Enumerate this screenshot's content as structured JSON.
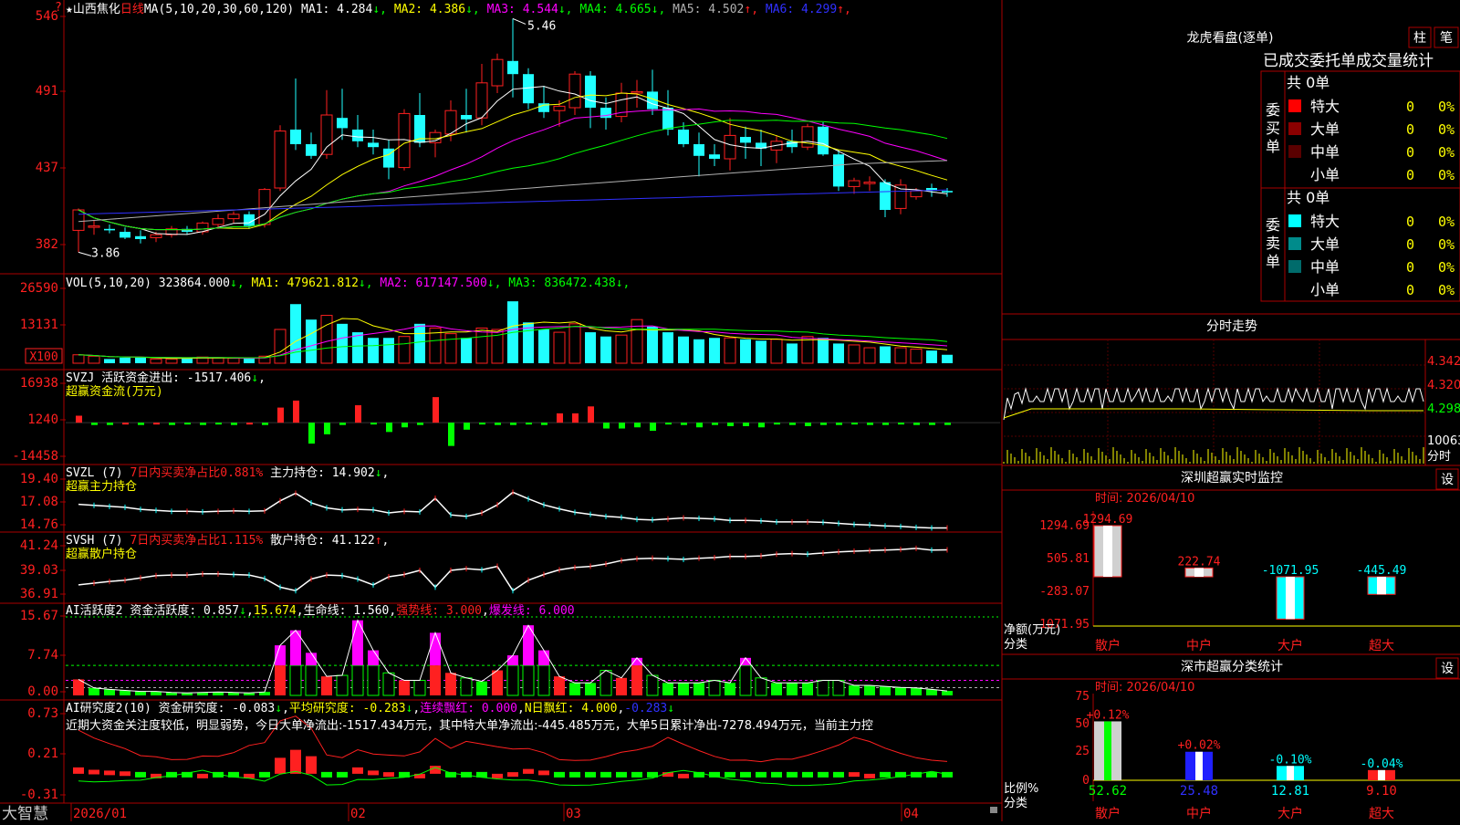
{
  "app": {
    "name": "大智慧",
    "top_icon": "?"
  },
  "colors": {
    "up": "#ff2020",
    "down": "#20ffff",
    "grid": "#aa0000",
    "white": "#ffffff",
    "yellow": "#ffff00",
    "magenta": "#ff00ff",
    "green": "#00ff00",
    "blue": "#3030ff",
    "gray": "#b0b0b0",
    "cyan": "#00ffff"
  },
  "main": {
    "star": "★",
    "stock_name": "山西焦化",
    "period": "日线",
    "ma_param": "MA(5,10,20,30,60,120)",
    "legend": [
      {
        "label": "MA1:",
        "value": "4.284",
        "arrow": "↓",
        "color": "#ffffff"
      },
      {
        "label": "MA2:",
        "value": "4.386",
        "arrow": "↓",
        "color": "#ffff00"
      },
      {
        "label": "MA3:",
        "value": "4.544",
        "arrow": "↓",
        "color": "#ff00ff"
      },
      {
        "label": "MA4:",
        "value": "4.665",
        "arrow": "↓",
        "color": "#00ff00"
      },
      {
        "label": "MA5:",
        "value": "4.502",
        "arrow": "↑",
        "color": "#b0b0b0"
      },
      {
        "label": "MA6:",
        "value": "4.299",
        "arrow": "↑",
        "color": "#3030ff"
      }
    ],
    "y_labels": [
      "546",
      "491",
      "437",
      "382"
    ],
    "high_label": "5.46",
    "low_label": "3.86"
  },
  "vol": {
    "title": "VOL(5,10,20)",
    "value": "323864.000",
    "arrow": "↓",
    "legend": [
      {
        "label": "MA1:",
        "value": "479621.812",
        "arrow": "↓",
        "color": "#ffff00"
      },
      {
        "label": "MA2:",
        "value": "617147.500",
        "arrow": "↓",
        "color": "#ff00ff"
      },
      {
        "label": "MA3:",
        "value": "836472.438",
        "arrow": "↓",
        "color": "#00ff00"
      }
    ],
    "y_labels": [
      "26590",
      "13131"
    ],
    "unit": "X100"
  },
  "svzj": {
    "title": "SVZJ",
    "desc": "活跃资金进出:",
    "value": "-1517.406",
    "arrow": "↓",
    "tail": ",",
    "subtitle": "超赢资金流(万元)",
    "y_labels": [
      "16938",
      "1240",
      "-14458"
    ]
  },
  "svzl": {
    "title": "SVZL (7)",
    "desc": "7日内买卖净占比0.881%",
    "hold_label": "主力持仓:",
    "hold_value": "14.902",
    "arrow": "↓",
    "tail": ",",
    "subtitle": "超赢主力持仓",
    "y_labels": [
      "19.40",
      "17.08",
      "14.76"
    ]
  },
  "svsh": {
    "title": "SVSH (7)",
    "desc": "7日内买卖净占比1.115%",
    "hold_label": "散户持仓:",
    "hold_value": "41.122",
    "arrow": "↑",
    "tail": ",",
    "subtitle": "超赢散户持仓",
    "y_labels": [
      "41.24",
      "39.03",
      "36.91"
    ]
  },
  "ai_act": {
    "title": "AI活跃度2",
    "items": [
      {
        "text": "资金活跃度: 0.857",
        "arrow": "↓",
        "color": "#ffffff"
      },
      {
        "text": "15.674",
        "arrow": "",
        "color": "#ffff00",
        "prefix": ","
      },
      {
        "text": "生命线: 1.560",
        "arrow": "",
        "color": "#ffffff",
        "prefix": ","
      },
      {
        "text": "强势线: 3.000",
        "arrow": "",
        "color": "#ff2020",
        "prefix": ","
      },
      {
        "text": "爆发线: 6.000",
        "arrow": "",
        "color": "#ff00ff",
        "prefix": ","
      }
    ],
    "y_labels": [
      "15.67",
      "7.74",
      "0.00"
    ]
  },
  "ai_res": {
    "title": "AI研究度2(10)",
    "items": [
      {
        "text": "资金研究度: -0.083",
        "arrow": "↓",
        "color": "#ffffff"
      },
      {
        "text": "平均研究度: -0.283",
        "arrow": "↓",
        "color": "#ffff00",
        "prefix": ","
      },
      {
        "text": "连续飘红: 0.000",
        "arrow": "",
        "color": "#ff00ff",
        "prefix": ","
      },
      {
        "text": "N日飘红: 4.000",
        "arrow": "",
        "color": "#ffff00",
        "prefix": ","
      },
      {
        "text": "-0.283",
        "arrow": "↓",
        "color": "#3030ff",
        "prefix": ","
      }
    ],
    "comment": "近期大资金关注度较低，明显弱势，今日大单净流出:-1517.434万元，其中特大单净流出:-445.485万元，大单5日累计净出-7278.494万元，当前主力控",
    "y_labels": [
      "0.73",
      "0.21",
      "-0.31"
    ]
  },
  "x_axis": {
    "labels": [
      "2026/01",
      "02",
      "03",
      "04"
    ]
  },
  "right": {
    "dragon_title": "龙虎看盘(逐单)",
    "btn1": "柱",
    "btn2": "笔",
    "stat_header": "已成交委托单成交量统计",
    "buy_side": "委买单",
    "sell_side": "委卖单",
    "buy_total": "共 0单",
    "sell_total": "共 0单",
    "buy_rows": [
      {
        "name": "特大",
        "count": "0",
        "pct": "0%",
        "color": "#ff0000"
      },
      {
        "name": "大单",
        "count": "0",
        "pct": "0%",
        "color": "#8b0000"
      },
      {
        "name": "中单",
        "count": "0",
        "pct": "0%",
        "color": "#5a0000"
      },
      {
        "name": "小单",
        "count": "0",
        "pct": "0%",
        "color": "#000000"
      }
    ],
    "sell_rows": [
      {
        "name": "特大",
        "count": "0",
        "pct": "0%",
        "color": "#00ffff"
      },
      {
        "name": "大单",
        "count": "0",
        "pct": "0%",
        "color": "#008b8b"
      },
      {
        "name": "中单",
        "count": "0",
        "pct": "0%",
        "color": "#006b6b"
      },
      {
        "name": "小单",
        "count": "0",
        "pct": "0%",
        "color": "#000000"
      }
    ],
    "tick_title": "分时走势",
    "tick_labels": [
      "4.342",
      "4.320",
      "4.298",
      "10063",
      "分时"
    ],
    "sz_title": "深圳超赢实时监控",
    "settings": "设",
    "sz_time": "时间: 2026/04/10",
    "sz_y": [
      "1294.69",
      "505.81",
      "-283.07",
      "-1071.95"
    ],
    "sz_unit": "净额(万元)",
    "sz_cat_label": "分类",
    "categories": [
      "散户",
      "中户",
      "大户",
      "超大"
    ],
    "sz_values": [
      "1294.69",
      "222.74",
      "-1071.95",
      "-445.49"
    ],
    "cls_title": "深市超赢分类统计",
    "cls_time": "时间: 2026/04/10",
    "cls_y": [
      "75",
      "50",
      "25",
      "0"
    ],
    "cls_unit": "比例%",
    "cls_cat_label": "分类",
    "cls_top": [
      "+0.12%",
      "+0.02%",
      "-0.10%",
      "-0.04%"
    ],
    "cls_bottom": [
      "52.62",
      "25.48",
      "12.81",
      "9.10"
    ]
  },
  "chart_data": [
    {
      "type": "candlestick",
      "title": "山西焦化 日线",
      "ylim": [
        3.8,
        5.5
      ],
      "high": 5.46,
      "low": 3.86,
      "candles": [
        [
          4.01,
          4.16,
          3.86,
          4.15
        ],
        [
          4.04,
          4.08,
          3.98,
          4.04
        ],
        [
          4.02,
          4.05,
          3.99,
          4.01
        ],
        [
          4.0,
          4.03,
          3.95,
          3.96
        ],
        [
          3.97,
          4.01,
          3.92,
          3.95
        ],
        [
          3.96,
          4.0,
          3.93,
          3.98
        ],
        [
          3.98,
          4.04,
          3.96,
          4.02
        ],
        [
          4.02,
          4.04,
          3.98,
          4.0
        ],
        [
          4.0,
          4.07,
          3.98,
          4.06
        ],
        [
          4.05,
          4.12,
          4.02,
          4.09
        ],
        [
          4.09,
          4.14,
          4.06,
          4.12
        ],
        [
          4.12,
          4.14,
          4.02,
          4.04
        ],
        [
          4.05,
          4.3,
          4.03,
          4.29
        ],
        [
          4.3,
          4.73,
          4.28,
          4.69
        ],
        [
          4.7,
          5.05,
          4.56,
          4.6
        ],
        [
          4.6,
          4.68,
          4.5,
          4.52
        ],
        [
          4.53,
          4.97,
          4.5,
          4.8
        ],
        [
          4.78,
          4.98,
          4.63,
          4.71
        ],
        [
          4.7,
          4.8,
          4.58,
          4.62
        ],
        [
          4.61,
          4.7,
          4.53,
          4.58
        ],
        [
          4.57,
          4.63,
          4.36,
          4.44
        ],
        [
          4.44,
          4.84,
          4.42,
          4.81
        ],
        [
          4.8,
          4.95,
          4.58,
          4.61
        ],
        [
          4.61,
          4.7,
          4.51,
          4.68
        ],
        [
          4.67,
          4.9,
          4.62,
          4.83
        ],
        [
          4.8,
          4.98,
          4.68,
          4.77
        ],
        [
          4.78,
          5.15,
          4.73,
          5.02
        ],
        [
          5.0,
          5.22,
          4.95,
          5.18
        ],
        [
          5.17,
          5.46,
          4.92,
          5.08
        ],
        [
          5.08,
          5.12,
          4.84,
          4.88
        ],
        [
          4.88,
          5.0,
          4.78,
          4.82
        ],
        [
          4.83,
          4.9,
          4.72,
          4.86
        ],
        [
          4.85,
          5.1,
          4.8,
          5.08
        ],
        [
          5.07,
          5.1,
          4.71,
          4.85
        ],
        [
          4.85,
          4.92,
          4.7,
          4.78
        ],
        [
          4.79,
          5.02,
          4.75,
          4.95
        ],
        [
          4.95,
          5.04,
          4.85,
          4.96
        ],
        [
          4.96,
          5.11,
          4.8,
          4.84
        ],
        [
          4.85,
          4.97,
          4.66,
          4.7
        ],
        [
          4.7,
          4.75,
          4.58,
          4.6
        ],
        [
          4.6,
          4.68,
          4.38,
          4.52
        ],
        [
          4.53,
          4.6,
          4.45,
          4.5
        ],
        [
          4.5,
          4.78,
          4.42,
          4.66
        ],
        [
          4.65,
          4.72,
          4.5,
          4.61
        ],
        [
          4.61,
          4.7,
          4.45,
          4.57
        ],
        [
          4.56,
          4.66,
          4.47,
          4.62
        ],
        [
          4.62,
          4.7,
          4.54,
          4.58
        ],
        [
          4.58,
          4.74,
          4.56,
          4.72
        ],
        [
          4.72,
          4.75,
          4.52,
          4.53
        ],
        [
          4.53,
          4.56,
          4.28,
          4.31
        ],
        [
          4.31,
          4.37,
          4.26,
          4.35
        ],
        [
          4.33,
          4.38,
          4.28,
          4.34
        ],
        [
          4.34,
          4.36,
          4.1,
          4.15
        ],
        [
          4.16,
          4.36,
          4.12,
          4.32
        ],
        [
          4.24,
          4.3,
          4.22,
          4.28
        ],
        [
          4.3,
          4.33,
          4.24,
          4.28
        ],
        [
          4.28,
          4.3,
          4.24,
          4.27
        ]
      ]
    },
    {
      "type": "bar",
      "title": "VOL(5,10,20)",
      "ylim": [
        0,
        26590
      ],
      "values": [
        3000,
        2500,
        1500,
        2000,
        2000,
        1500,
        1500,
        1800,
        2200,
        2000,
        1800,
        1600,
        2500,
        12000,
        21000,
        15500,
        17000,
        14000,
        11000,
        9000,
        9000,
        9500,
        14000,
        12500,
        10500,
        9000,
        12500,
        12000,
        22000,
        14500,
        12000,
        11000,
        14000,
        11000,
        9500,
        10000,
        15500,
        13000,
        11000,
        9500,
        8500,
        9000,
        9000,
        8500,
        8000,
        8500,
        7000,
        9500,
        9000,
        7000,
        6500,
        5500,
        6000,
        5500,
        5000,
        4500,
        3000
      ]
    },
    {
      "type": "bar",
      "title": "超赢资金流(万元)",
      "ylim": [
        -14458,
        16938
      ],
      "values": [
        3000,
        -1000,
        -1000,
        0,
        -1000,
        0,
        -1000,
        -500,
        -1000,
        -500,
        -1000,
        0,
        -1000,
        6500,
        9500,
        -9000,
        -5000,
        -1000,
        7500,
        -500,
        -4000,
        -2000,
        -1000,
        11000,
        -10000,
        -3000,
        -500,
        -1000,
        -1000,
        -500,
        -1000,
        4000,
        4000,
        7000,
        -2500,
        -2500,
        -2000,
        -3500,
        -500,
        -1000,
        -2000,
        -1000,
        -1500,
        -1500,
        -2000,
        -500,
        -1000,
        -1500,
        -1000,
        -1000,
        -500,
        -1000,
        -1000,
        -500,
        -1000,
        -1000,
        -1000
      ]
    },
    {
      "type": "line",
      "title": "超赢主力持仓",
      "ylim": [
        14.76,
        19.4
      ],
      "values": [
        17.25,
        17.15,
        17.05,
        16.95,
        16.75,
        16.65,
        16.55,
        16.55,
        16.5,
        16.55,
        16.6,
        16.55,
        16.6,
        17.6,
        18.35,
        17.4,
        16.9,
        16.7,
        16.75,
        16.7,
        16.4,
        16.55,
        16.5,
        17.85,
        16.2,
        16.05,
        16.4,
        17.2,
        18.45,
        17.8,
        17.2,
        16.8,
        16.45,
        16.25,
        16.05,
        15.95,
        15.75,
        15.7,
        15.8,
        15.9,
        15.85,
        15.8,
        15.65,
        15.65,
        15.6,
        15.5,
        15.5,
        15.5,
        15.45,
        15.35,
        15.25,
        15.2,
        15.1,
        15.05,
        14.95,
        14.9,
        14.9
      ]
    },
    {
      "type": "line",
      "title": "超赢散户持仓",
      "ylim": [
        36.91,
        41.24
      ],
      "values": [
        38.1,
        38.25,
        38.4,
        38.5,
        38.7,
        38.9,
        38.95,
        38.95,
        39.05,
        39.05,
        39.0,
        38.95,
        38.65,
        37.9,
        37.6,
        38.6,
        38.95,
        38.9,
        38.6,
        38.1,
        38.8,
        39.0,
        39.35,
        37.9,
        39.35,
        39.5,
        39.4,
        39.7,
        37.6,
        38.5,
        39.0,
        39.4,
        39.6,
        39.7,
        39.9,
        40.2,
        40.35,
        40.4,
        40.35,
        40.3,
        40.4,
        40.45,
        40.55,
        40.55,
        40.6,
        40.75,
        40.8,
        40.75,
        40.85,
        40.95,
        41.0,
        41.05,
        41.1,
        41.15,
        41.25,
        41.1,
        41.12
      ]
    },
    {
      "type": "bar",
      "title": "AI活跃度2",
      "ylim": [
        0,
        15.67
      ],
      "values": [
        3.2,
        1.5,
        1.2,
        1.0,
        0.8,
        0.8,
        0.6,
        0.5,
        0.6,
        0.7,
        0.6,
        0.5,
        0.7,
        10.0,
        13.0,
        8.5,
        3.8,
        4.0,
        15.0,
        9.0,
        4.5,
        3.0,
        3.0,
        12.5,
        4.5,
        3.5,
        2.8,
        5.0,
        8.0,
        14.0,
        9.0,
        3.8,
        2.5,
        2.5,
        5.0,
        3.5,
        7.5,
        4.0,
        2.5,
        2.5,
        2.5,
        3.0,
        2.5,
        7.5,
        3.5,
        2.5,
        2.5,
        2.5,
        3.0,
        3.0,
        2.0,
        2.0,
        1.8,
        1.6,
        1.5,
        1.2,
        0.9
      ],
      "lines": {
        "强势线": 3.0,
        "爆发线": 6.0,
        "生命线": 1.56
      }
    },
    {
      "type": "bar",
      "title": "AI研究度2(10)",
      "ylim": [
        -0.31,
        0.73
      ],
      "values": [
        0.08,
        0.05,
        0.04,
        0.03,
        -0.01,
        0.0,
        -0.02,
        -0.02,
        0.0,
        -0.03,
        -0.03,
        0.0,
        -0.02,
        0.2,
        0.3,
        0.22,
        -0.02,
        -0.02,
        0.08,
        0.04,
        0.02,
        -0.01,
        0.0,
        0.1,
        -0.05,
        -0.03,
        -0.02,
        0.0,
        0.02,
        0.06,
        0.04,
        -0.02,
        -0.03,
        -0.04,
        -0.03,
        -0.02,
        -0.04,
        -0.05,
        0.02,
        0.0,
        -0.02,
        -0.04,
        -0.05,
        -0.03,
        -0.04,
        -0.02,
        -0.04,
        -0.03,
        -0.02,
        -0.01,
        0.02,
        0.0,
        -0.02,
        -0.03,
        -0.04,
        -0.04,
        -0.04
      ]
    },
    {
      "type": "bar",
      "title": "深圳超赢实时监控",
      "categories": [
        "散户",
        "中户",
        "大户",
        "超大"
      ],
      "values": [
        1294.69,
        222.74,
        -1071.95,
        -445.49
      ],
      "ylim": [
        -1071.95,
        1294.69
      ],
      "ylabel": "净额(万元)"
    },
    {
      "type": "bar",
      "title": "深市超赢分类统计",
      "categories": [
        "散户",
        "中户",
        "大户",
        "超大"
      ],
      "values": [
        52.62,
        25.48,
        12.81,
        9.1
      ],
      "changes": [
        "+0.12%",
        "+0.02%",
        "-0.10%",
        "-0.04%"
      ],
      "ylim": [
        0,
        75
      ],
      "ylabel": "比例%"
    }
  ]
}
